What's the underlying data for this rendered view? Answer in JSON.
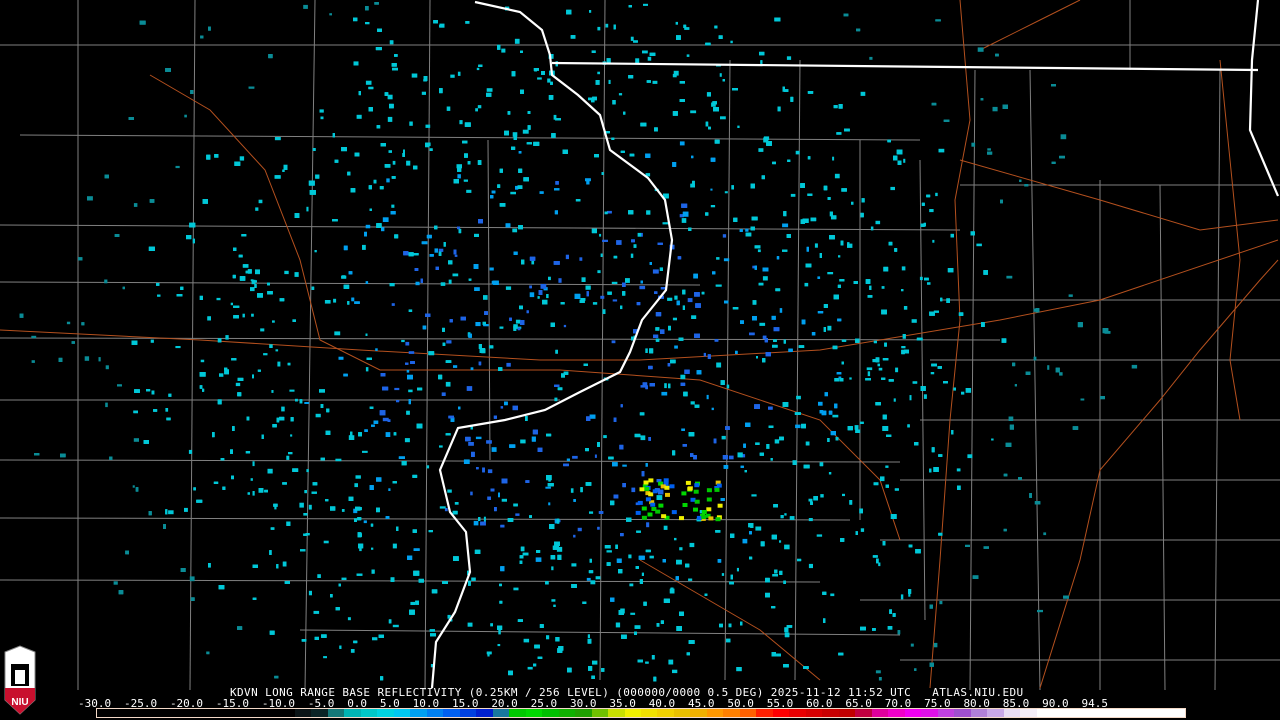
{
  "product": {
    "title": "KDVN LONG RANGE BASE REFLECTIVITY (0.25KM / 256 LEVEL) (000000/0000 0.5 DEG) 2025-11-12 11:52 UTC   ATLAS.NIU.EDU",
    "logo_text": "NIU"
  },
  "legend": {
    "labels": [
      "-30.0",
      "-25.0",
      "-20.0",
      "-15.0",
      "-10.0",
      "-5.0",
      "0.0",
      "5.0",
      "10.0",
      "15.0",
      "20.0",
      "25.0",
      "30.0",
      "35.0",
      "40.0",
      "45.0",
      "50.0",
      "55.0",
      "60.0",
      "65.0",
      "70.0",
      "75.0",
      "80.0",
      "85.0",
      "90.0",
      "94.5"
    ],
    "colors": [
      "#000000",
      "#000000",
      "#000000",
      "#000000",
      "#000000",
      "#000000",
      "#000000",
      "#000000",
      "#000000",
      "#000000",
      "#000000",
      "#000000",
      "#0a1416",
      "#0a2426",
      "#147878",
      "#00b4b4",
      "#00c8c8",
      "#00d4e0",
      "#00c8f0",
      "#00a0f0",
      "#0080f0",
      "#0060f0",
      "#0040e0",
      "#0020d0",
      "#1878a0",
      "#00c800",
      "#00d800",
      "#00c000",
      "#10b000",
      "#20a000",
      "#70c000",
      "#c8e000",
      "#f0f000",
      "#f0e000",
      "#f0d000",
      "#e8c000",
      "#f0b000",
      "#ff9800",
      "#ff8000",
      "#ff6000",
      "#ff2000",
      "#ff0000",
      "#e80000",
      "#d80000",
      "#c80000",
      "#c00000",
      "#c00040",
      "#e0009c",
      "#f000c8",
      "#f000f0",
      "#e010e8",
      "#c040e0",
      "#a050d0",
      "#b080d8",
      "#c8a8e8",
      "#e8dcf4",
      "#f4eef8",
      "#ffffff",
      "#ffffff",
      "#ffffff",
      "#ffffff",
      "#ffffff",
      "#ffffff",
      "#ffffff",
      "#ffffff",
      "#ffffff"
    ]
  },
  "colors": {
    "state_line": "#ffffff",
    "county_line": "#808080",
    "highway": "#b4501e",
    "radar_echo": "#00c8d8"
  }
}
